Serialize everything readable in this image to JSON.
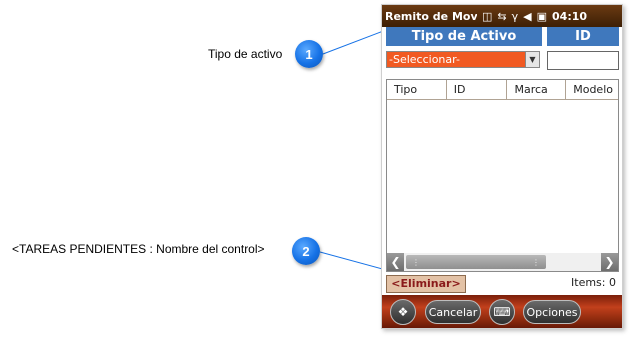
{
  "callouts": [
    {
      "number": "1",
      "label": "Tipo de activo"
    },
    {
      "number": "2",
      "label": "<TAREAS PENDIENTES : Nombre del control>"
    }
  ],
  "device": {
    "app_title": "Remito de Movii",
    "time": "04:10",
    "status_icons": [
      "notification-icon",
      "sync-icon",
      "signal-icon",
      "speaker-icon",
      "battery-icon"
    ]
  },
  "form": {
    "tipo_header": "Tipo de Activo",
    "id_header": "ID",
    "tipo_selected": "-Seleccionar-",
    "id_value": ""
  },
  "grid": {
    "columns": [
      "Tipo",
      "ID",
      "Marca",
      "Modelo"
    ],
    "rows": []
  },
  "actions": {
    "eliminar_label": "<Eliminar>",
    "items_label": "Items: 0"
  },
  "softbar": {
    "cancel_label": "Cancelar",
    "options_label": "Opciones"
  },
  "colors": {
    "header_blue": "#3f78bd",
    "status_brown": "#4a260a",
    "combo_orange": "#f15a22",
    "badge_blue": "#1672e6"
  }
}
